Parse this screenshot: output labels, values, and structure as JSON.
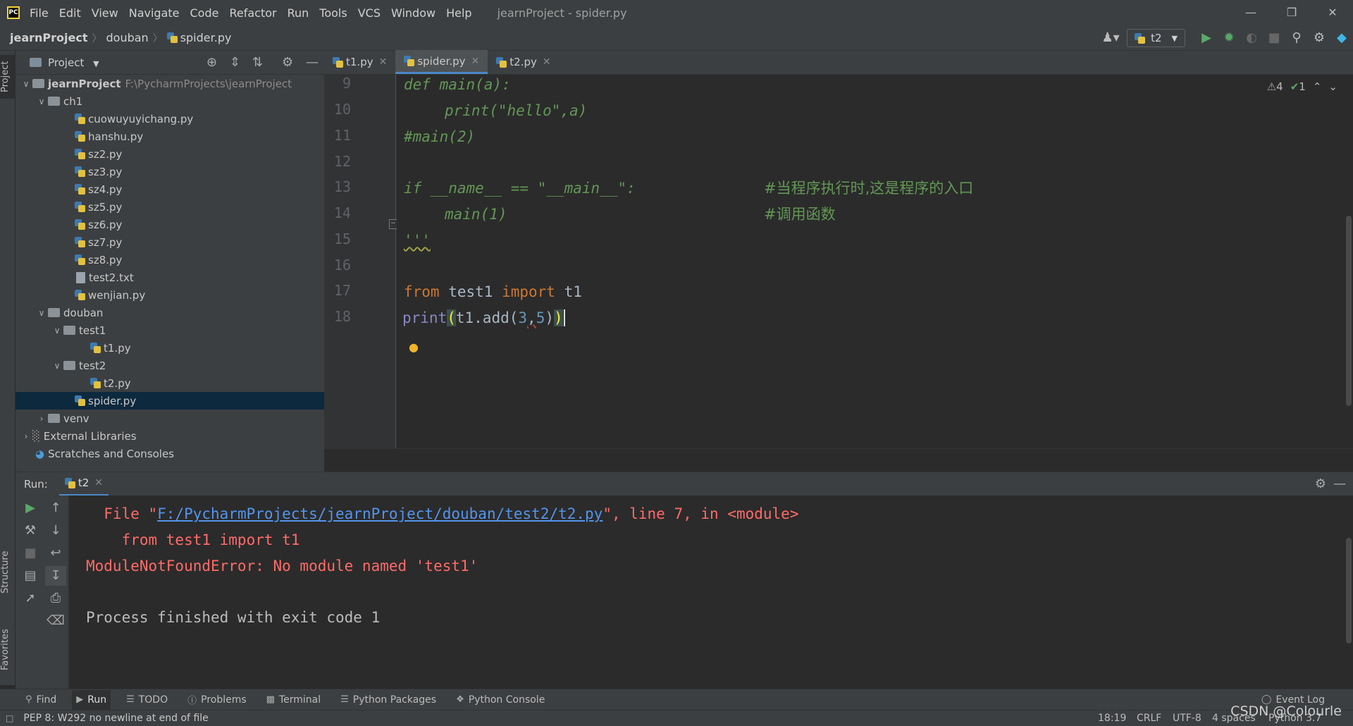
{
  "app": {
    "window_title": "jearnProject - spider.py",
    "menu": [
      "File",
      "Edit",
      "View",
      "Navigate",
      "Code",
      "Refactor",
      "Run",
      "Tools",
      "VCS",
      "Window",
      "Help"
    ]
  },
  "breadcrumb": [
    "jearnProject",
    "douban",
    "spider.py"
  ],
  "run_config": "t2",
  "project": {
    "header": "Project",
    "root_name": "jearnProject",
    "root_path": "F:\\PycharmProjects\\jearnProject",
    "ch1": "ch1",
    "ch1_files": [
      "cuowuyuyichang.py",
      "hanshu.py",
      "sz2.py",
      "sz3.py",
      "sz4.py",
      "sz5.py",
      "sz6.py",
      "sz7.py",
      "sz8.py",
      "test2.txt",
      "wenjian.py"
    ],
    "douban": "douban",
    "test1": "test1",
    "test1_file": "t1.py",
    "test2": "test2",
    "test2_file": "t2.py",
    "spider": "spider.py",
    "venv": "venv",
    "external": "External Libraries",
    "scratches": "Scratches and Consoles"
  },
  "editor": {
    "tabs": [
      "t1.py",
      "spider.py",
      "t2.py"
    ],
    "active_tab": "spider.py",
    "line_numbers": [
      "9",
      "10",
      "11",
      "12",
      "13",
      "14",
      "15",
      "16",
      "17",
      "18"
    ],
    "code": {
      "l9": "def main(a):",
      "l10_fn": "print",
      "l10_rest": "(\"hello\",a)",
      "l11": "#main(2)",
      "l13_code": "if __name__ == \"__main__\":",
      "l13_comment": "#当程序执行时,这是程序的入口",
      "l14_code": "main(1)",
      "l14_comment": "#调用函数",
      "l15": "'''",
      "l17_from": "from",
      "l17_mod": " test1 ",
      "l17_import": "import",
      "l17_name": " t1",
      "l18_print": "print",
      "l18_open": "(",
      "l18_mid": "t1.add(",
      "l18_a": "3",
      "l18_comma": ",",
      "l18_b": "5",
      "l18_close1": ")",
      "l18_close2": ")"
    },
    "inspections": {
      "warnings": "4",
      "ok": "1"
    }
  },
  "run_panel": {
    "label": "Run:",
    "tab": "t2",
    "output": {
      "l1_prefix": "  File \"",
      "l1_link": "F:/PycharmProjects/jearnProject/douban/test2/t2.py",
      "l1_suffix": "\", line 7, in <module>",
      "l2": "    from test1 import t1",
      "l3": "ModuleNotFoundError: No module named 'test1'",
      "l5": "Process finished with exit code 1"
    }
  },
  "tool_windows": [
    "Find",
    "Run",
    "TODO",
    "Problems",
    "Terminal",
    "Python Packages",
    "Python Console"
  ],
  "event_log": "Event Log",
  "side_tabs": {
    "project": "Project",
    "structure": "Structure",
    "favorites": "Favorites"
  },
  "status": {
    "message": "PEP 8: W292 no newline at end of file",
    "position": "18:19",
    "line_sep": "CRLF",
    "encoding": "UTF-8",
    "indent": "4 spaces",
    "interpreter": "Python 3.7"
  },
  "watermark": "CSDN @Colourle"
}
